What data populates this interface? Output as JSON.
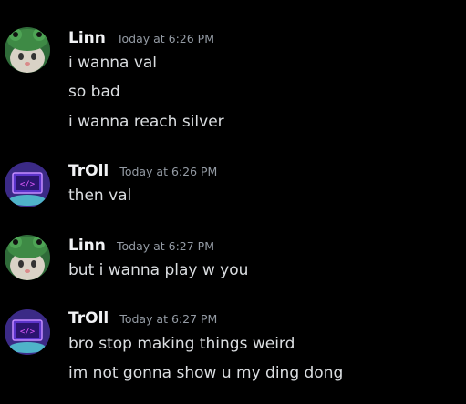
{
  "messages": [
    {
      "author": "Linn",
      "timestamp": "Today at 6:26 PM",
      "lines": [
        "i wanna val",
        "so bad",
        "i wanna reach silver"
      ]
    },
    {
      "author": "TrOll",
      "timestamp": "Today at 6:26 PM",
      "lines": [
        "then val"
      ]
    },
    {
      "author": "Linn",
      "timestamp": "Today at 6:27 PM",
      "lines": [
        "but i wanna play w you"
      ]
    },
    {
      "author": "TrOll",
      "timestamp": "Today at 6:27 PM",
      "lines": [
        "bro stop making things weird",
        "im not gonna show u my ding dong"
      ]
    }
  ],
  "avatars": {
    "linn": "frog-hat-cat-avatar",
    "troll": "neon-computer-avatar"
  },
  "colors": {
    "background": "#000000",
    "username": "#f2f3f5",
    "timestamp": "#949ba4",
    "message_text": "#dbdee1"
  }
}
